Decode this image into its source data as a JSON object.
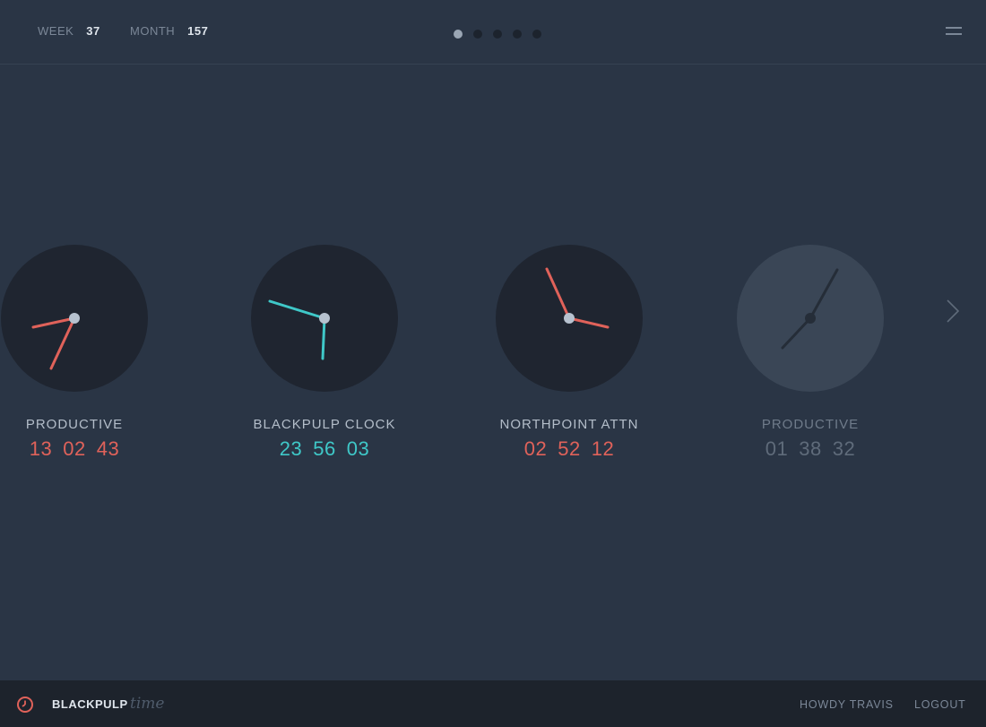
{
  "header": {
    "week_label": "WEEK",
    "week_value": "37",
    "month_label": "MONTH",
    "month_value": "157",
    "pager": {
      "pages": 5,
      "active_index": 0
    },
    "menu_icon": "hamburger-menu-icon"
  },
  "clocks": [
    {
      "label": "PRODUCTIVE",
      "hours": "13",
      "minutes": "02",
      "seconds": "43",
      "color": "#e0625a",
      "state": "active"
    },
    {
      "label": "BLACKPULP CLOCK",
      "hours": "23",
      "minutes": "56",
      "seconds": "03",
      "color": "#3fc8c8",
      "state": "active"
    },
    {
      "label": "NORTHPOINT ATTN",
      "hours": "02",
      "minutes": "52",
      "seconds": "12",
      "color": "#e0625a",
      "state": "active"
    },
    {
      "label": "PRODUCTIVE",
      "hours": "01",
      "minutes": "38",
      "seconds": "32",
      "color": "#5f6b7a",
      "state": "inactive"
    }
  ],
  "navigation": {
    "next_icon": "chevron-right-icon"
  },
  "footer": {
    "logo_icon": "clock-icon",
    "brand": "BLACKPULP",
    "brand_sub": "time",
    "greeting": "HOWDY TRAVIS",
    "logout": "LOGOUT"
  },
  "colors": {
    "background": "#2a3545",
    "dial": "#1f2530",
    "dial_inactive": "#3a4656",
    "accent_red": "#e0625a",
    "accent_teal": "#3fc8c8",
    "footer_bg": "#1d232c"
  }
}
